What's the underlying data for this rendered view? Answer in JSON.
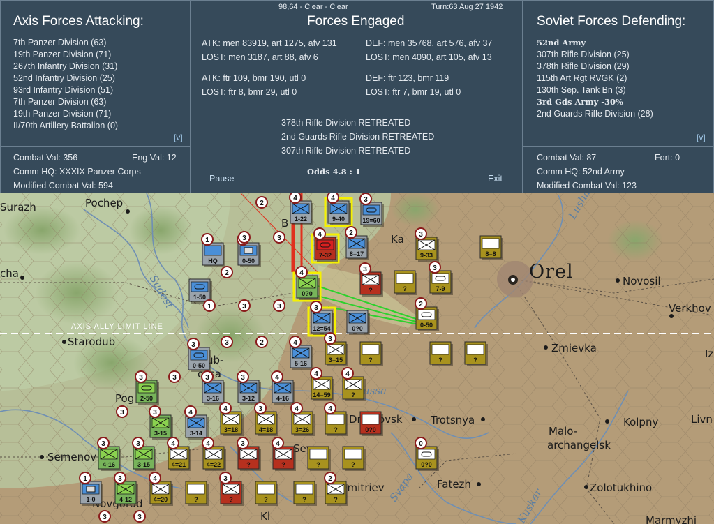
{
  "status": {
    "weather": "98,64 - Clear - Clear",
    "turn": "Turn:63  Aug 27 1942"
  },
  "axis_panel": {
    "title": "Axis Forces Attacking:",
    "units": [
      "7th Panzer Division (63)",
      "19th Panzer Division (71)",
      "267th Infantry Division (31)",
      "52nd Infantry Division (25)",
      "93rd Infantry Division (51)",
      "7th Panzer Division (63)",
      "19th Panzer Division (71)",
      "II/70th Artillery Battalion (0)"
    ],
    "expand": "[v]",
    "combat_val": "Combat Val: 356",
    "eng_val": "Eng Val: 12",
    "comm_hq": "Comm HQ: XXXIX Panzer Corps",
    "modified": "Modified Combat Val: 594"
  },
  "center_panel": {
    "title": "Forces Engaged",
    "atk_line1": "ATK: men 83919, art 1275, afv 131",
    "atk_lost1": "LOST: men 3187, art 88, afv 6",
    "atk_line2": "ATK: ftr 109, bmr 190, utl 0",
    "atk_lost2": "LOST: ftr 8, bmr 29, utl 0",
    "def_line1": "DEF: men 35768, art 576, afv 37",
    "def_lost1": "LOST: men 4090, art 105, afv 13",
    "def_line2": "DEF: ftr 123, bmr 119",
    "def_lost2": "LOST: ftr 7, bmr 19, utl 0",
    "results": [
      "378th Rifle Division RETREATED",
      "2nd Guards Rifle Division RETREATED",
      "307th Rifle Division RETREATED"
    ],
    "odds": "Odds 4.8 : 1",
    "pause": "Pause",
    "exit": "Exit"
  },
  "soviet_panel": {
    "title": "Soviet Forces Defending:",
    "units": [
      "52nd Army",
      "307th Rifle Division (25)",
      "378th Rifle Division (29)",
      "115th Art Rgt RVGK (2)",
      "130th Sep. Tank Bn (3)",
      "3rd Gds Army  -30%",
      "2nd Guards Rifle Division (28)"
    ],
    "expand": "[v]",
    "combat_val": "Combat Val: 87",
    "fort": "Fort: 0",
    "comm_hq": "Comm HQ: 52nd Army",
    "modified": "Modified Combat Val: 123"
  },
  "map": {
    "limit_line": "AXIS ALLY LIMIT LINE",
    "cities": [
      "Pochep",
      "Surazh",
      "cha",
      "Starodub",
      "Pog",
      "Semenov",
      "Novgorod",
      "Orel",
      "Novosil",
      "Verkhov",
      "Zmievka",
      "Trotsnya",
      "Malo-",
      "archangelsk",
      "Kolpny",
      "Livn",
      "Fatezh",
      "Zolotukhino",
      "Dmitrovsk",
      "Dmitriev",
      "Iz",
      "Sev",
      "Ka",
      "Kl",
      "ub-",
      "ossa",
      "B",
      "Marmyzhi"
    ],
    "rivers": [
      "Sudost",
      "Lusha",
      "ussa",
      "Svapa",
      "Kuskar"
    ],
    "counter_labels": [
      "HQ",
      "0-50",
      "1-50",
      "0-50",
      "1-22",
      "9-40",
      "19=60",
      "8=17",
      "7-32",
      "9-33",
      "8=8",
      "0?0",
      "?",
      "?",
      "7-9",
      "12=54",
      "0?0",
      "0-50",
      "5-16",
      "3=15",
      "?",
      "?",
      "?",
      "2-50",
      "3-16",
      "3-12",
      "4-16",
      "14=59",
      "?",
      "3-15",
      "3-14",
      "3=18",
      "4=18",
      "3=26",
      "?",
      "0?0",
      "4-16",
      "3-15",
      "4=21",
      "4=22",
      "?",
      "?",
      "?",
      "?",
      "0?0",
      "1-0",
      "4-12",
      "4=20",
      "?",
      "?",
      "?",
      "?",
      "?"
    ]
  },
  "colors": {
    "panel_bg": "#364a5a",
    "german_gray": "#9aa3ab",
    "soviet_tan": "#a8921e",
    "ally_green": "#77b35a",
    "selected_yellow": "#f5f000"
  }
}
